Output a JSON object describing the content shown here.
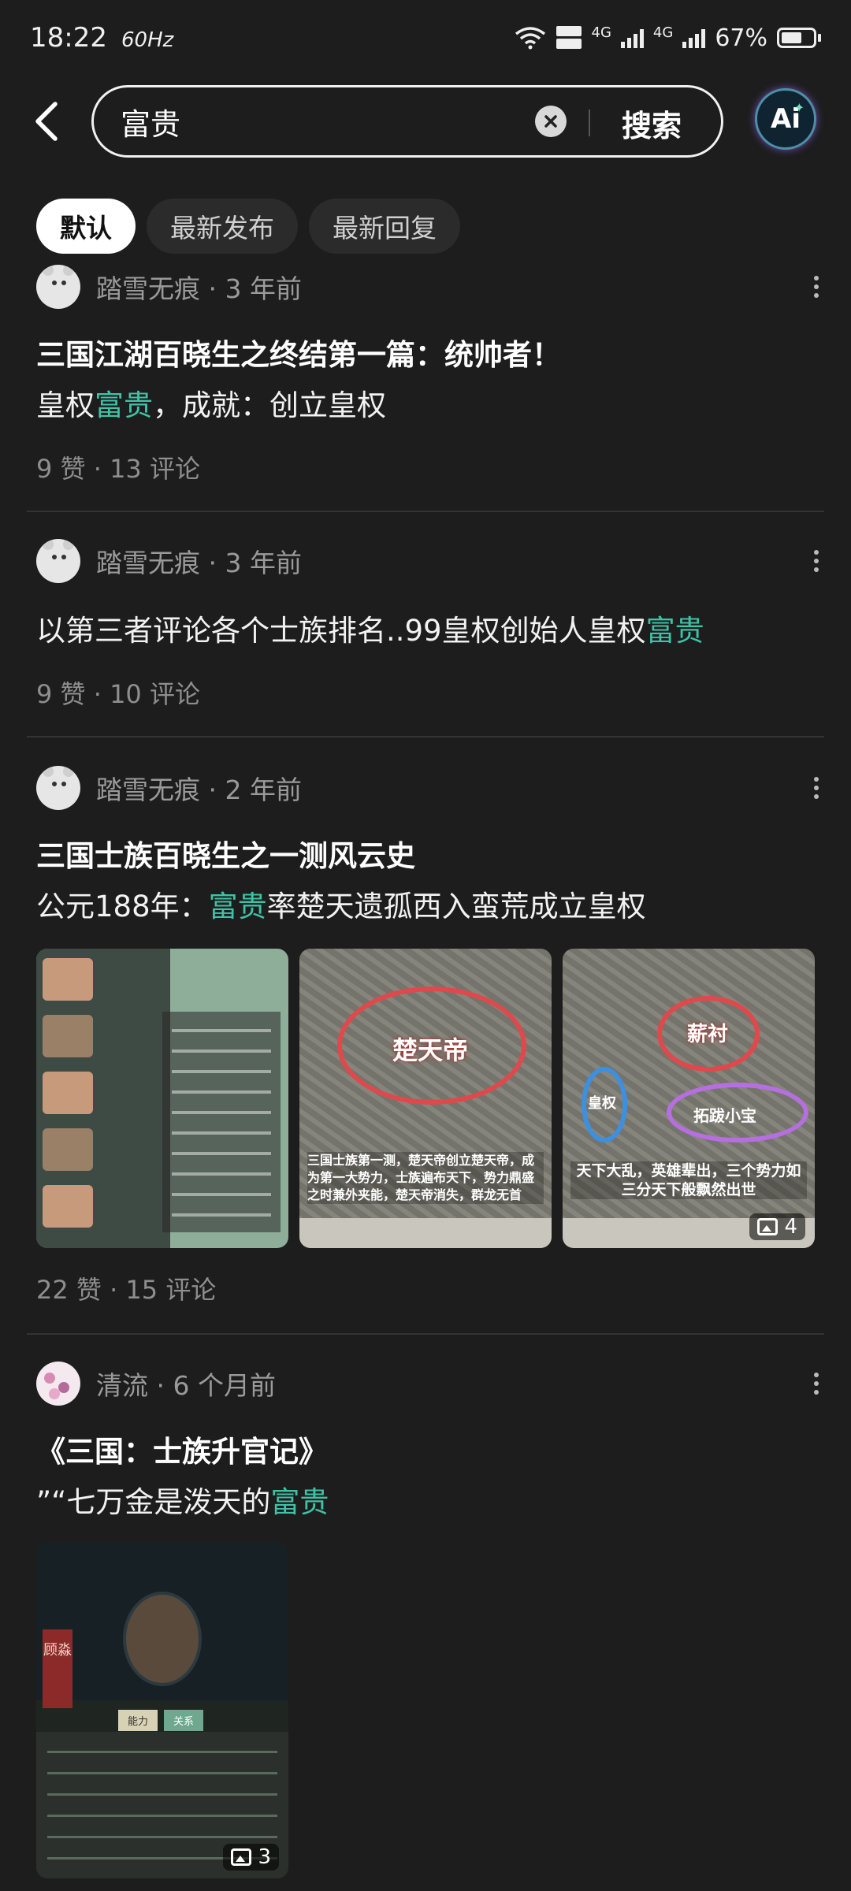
{
  "status_bar": {
    "time": "18:22",
    "refresh_rate": "60Hz",
    "network_1": "4G",
    "network_2": "4G",
    "battery": "67%",
    "battery_level": 0.67
  },
  "search": {
    "query": "富贵",
    "search_label": "搜索",
    "ai_label": "Ai"
  },
  "filters": [
    {
      "label": "默认",
      "active": true
    },
    {
      "label": "最新发布",
      "active": false
    },
    {
      "label": "最新回复",
      "active": false
    }
  ],
  "posts": [
    {
      "author": "踏雪无痕",
      "time": "3 年前",
      "title": "三国江湖百晓生之终结第一篇：统帅者！",
      "body_prefix": "皇权",
      "body_highlight": "富贵",
      "body_suffix": "，成就：创立皇权",
      "likes": "9 赞",
      "comments": "13 评论"
    },
    {
      "author": "踏雪无痕",
      "time": "3 年前",
      "body_prefix": "以第三者评论各个士族排名..99皇权创始人皇权",
      "body_highlight": "富贵",
      "likes": "9 赞",
      "comments": "10 评论"
    },
    {
      "author": "踏雪无痕",
      "time": "2 年前",
      "title": "三国士族百晓生之一测风云史",
      "body_prefix": " 公元188年：",
      "body_highlight": "富贵",
      "body_suffix": "率楚天遗孤西入蛮荒成立皇权",
      "image_2_label": "楚天帝",
      "image_2_note": "三国士族第一测，楚天帝创立楚天帝，成为第一大势力，士族遍布天下，势力鼎盛之时兼外夹能，楚天帝消失，群龙无首",
      "image_3_labels": [
        "薪衬",
        "皇权",
        "拓跋小宝"
      ],
      "image_3_note": "天下大乱，英雄辈出，三个势力如三分天下般飘然出世",
      "image_count": "4",
      "likes": "22 赞",
      "comments": "15 评论"
    },
    {
      "author": "清流",
      "time": "6 个月前",
      "title": "《三国：士族升官记》",
      "body_prefix": "”“七万金是泼天的",
      "body_highlight": "富贵",
      "image_tag": "顾淼",
      "image_tabs": [
        "能力",
        "关系"
      ],
      "image_count": "3"
    }
  ],
  "colors": {
    "background": "#1d1d1d",
    "highlight": "#3fc2a6",
    "muted_text": "#9a9a9a"
  }
}
